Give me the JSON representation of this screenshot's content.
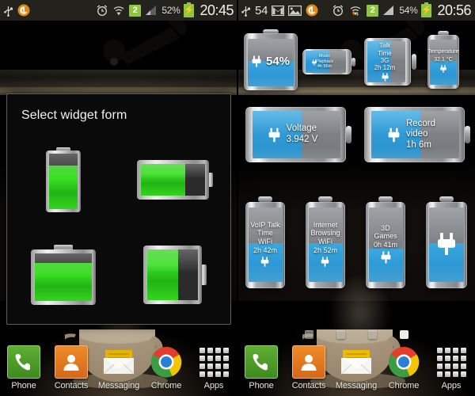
{
  "left_panel": {
    "status_bar": {
      "usb_icon": "usb-icon",
      "app_icon": "circle-app-icon",
      "alarm_icon": "alarm-clock-icon",
      "wifi_icon": "wifi-icon",
      "sim_badge": "2",
      "signal_icon": "signal-bars-icon",
      "battery_percent": "52%",
      "battery_icon": "battery-charging-icon",
      "clock": "20:45"
    },
    "dialog": {
      "title": "Select widget form",
      "forms": [
        {
          "name": "tall-vertical-battery",
          "shape": "vertical",
          "fill_percent": 78
        },
        {
          "name": "wide-horizontal-battery",
          "shape": "horizontal",
          "fill_percent": 70
        },
        {
          "name": "square-vertical-battery",
          "shape": "square-vertical",
          "fill_percent": 80
        },
        {
          "name": "square-horizontal-battery",
          "shape": "square-horizontal",
          "fill_percent": 62
        }
      ]
    },
    "dock": {
      "items": [
        {
          "label": "Phone",
          "icon": "phone-icon"
        },
        {
          "label": "Contacts",
          "icon": "contacts-person-icon"
        },
        {
          "label": "Messaging",
          "icon": "envelope-icon"
        },
        {
          "label": "Chrome",
          "icon": "chrome-icon"
        },
        {
          "label": "Apps",
          "icon": "apps-grid-icon"
        }
      ]
    }
  },
  "right_panel": {
    "status_bar": {
      "usb_icon": "usb-icon",
      "notification_count": "54",
      "gmail_icon": "gmail-icon",
      "image_icon": "picture-icon",
      "app_icon": "circle-app-icon",
      "alarm_icon": "alarm-clock-icon",
      "wifi_icon": "wifi-transfer-icon",
      "sim_badge": "2",
      "signal_icon": "signal-bars-icon",
      "battery_percent": "54%",
      "battery_icon": "battery-charging-icon",
      "clock": "20:56"
    },
    "widgets": [
      {
        "name": "battery-percent-widget",
        "shape": "square-vertical",
        "fill_percent": 54,
        "fill_from": "bottom",
        "plug_icon": "plug-icon",
        "lines": [
          "54%"
        ],
        "inline_plug": true
      },
      {
        "name": "music-playback-widget",
        "shape": "horizontal-small",
        "fill_percent": 58,
        "fill_from": "left",
        "plug_icon": "plug-icon",
        "lines": [
          "Music",
          "Playback",
          "4h 56m"
        ],
        "inline_plug": false
      },
      {
        "name": "talk-time-3g-widget",
        "shape": "square-horizontal",
        "fill_percent": 62,
        "fill_from": "left",
        "plug_icon": "plug-icon",
        "lines": [
          "Talk",
          "Time",
          "3G",
          "2h 12m"
        ],
        "inline_plug": false
      },
      {
        "name": "temperature-widget",
        "shape": "vertical-small",
        "fill_percent": 52,
        "fill_from": "bottom",
        "plug_icon": "plug-icon",
        "lines": [
          "Temperature",
          "32.1 °C"
        ],
        "inline_plug": false
      },
      {
        "name": "voltage-widget",
        "shape": "horizontal-wide",
        "fill_percent": 56,
        "fill_from": "left",
        "plug_icon": "plug-icon",
        "lines": [
          "Voltage",
          "3.942 V"
        ],
        "inline_plug": true
      },
      {
        "name": "record-video-widget",
        "shape": "horizontal-wide",
        "fill_percent": 56,
        "fill_from": "left",
        "plug_icon": "plug-icon",
        "lines": [
          "Record",
          "video",
          "1h 6m"
        ],
        "inline_plug": true
      },
      {
        "name": "voip-talk-time-wifi-widget",
        "shape": "vertical",
        "fill_percent": 52,
        "fill_from": "bottom",
        "plug_icon": "plug-icon",
        "lines": [
          "VoIP Talk",
          "Time",
          "WiFi",
          "2h 42m"
        ],
        "inline_plug": false
      },
      {
        "name": "internet-browsing-wifi-widget",
        "shape": "vertical",
        "fill_percent": 52,
        "fill_from": "bottom",
        "plug_icon": "plug-icon",
        "lines": [
          "Internet",
          "Browsing",
          "WiFi",
          "2h 52m"
        ],
        "inline_plug": false
      },
      {
        "name": "3d-games-widget",
        "shape": "vertical",
        "fill_percent": 45,
        "fill_from": "bottom",
        "plug_icon": "plug-icon",
        "lines": [
          "3D",
          "Games",
          "0h 41m"
        ],
        "inline_plug": false
      },
      {
        "name": "plain-battery-widget",
        "shape": "vertical",
        "fill_percent": 52,
        "fill_from": "bottom",
        "plug_icon": "plug-icon",
        "lines": [],
        "inline_plug": false
      }
    ],
    "page_indicator": {
      "total": 4,
      "active_index": 3
    },
    "dock": {
      "items": [
        {
          "label": "Phone",
          "icon": "phone-icon"
        },
        {
          "label": "Contacts",
          "icon": "contacts-person-icon"
        },
        {
          "label": "Messaging",
          "icon": "envelope-icon"
        },
        {
          "label": "Chrome",
          "icon": "chrome-icon"
        },
        {
          "label": "Apps",
          "icon": "apps-grid-icon"
        }
      ]
    }
  },
  "colors": {
    "accent_blue": "#2f9ad6",
    "accent_green": "#8ec63f",
    "battery_green": "#2fd11a",
    "status_bar_bg": "#24221d",
    "dialog_bg": "#0a0a0a"
  }
}
